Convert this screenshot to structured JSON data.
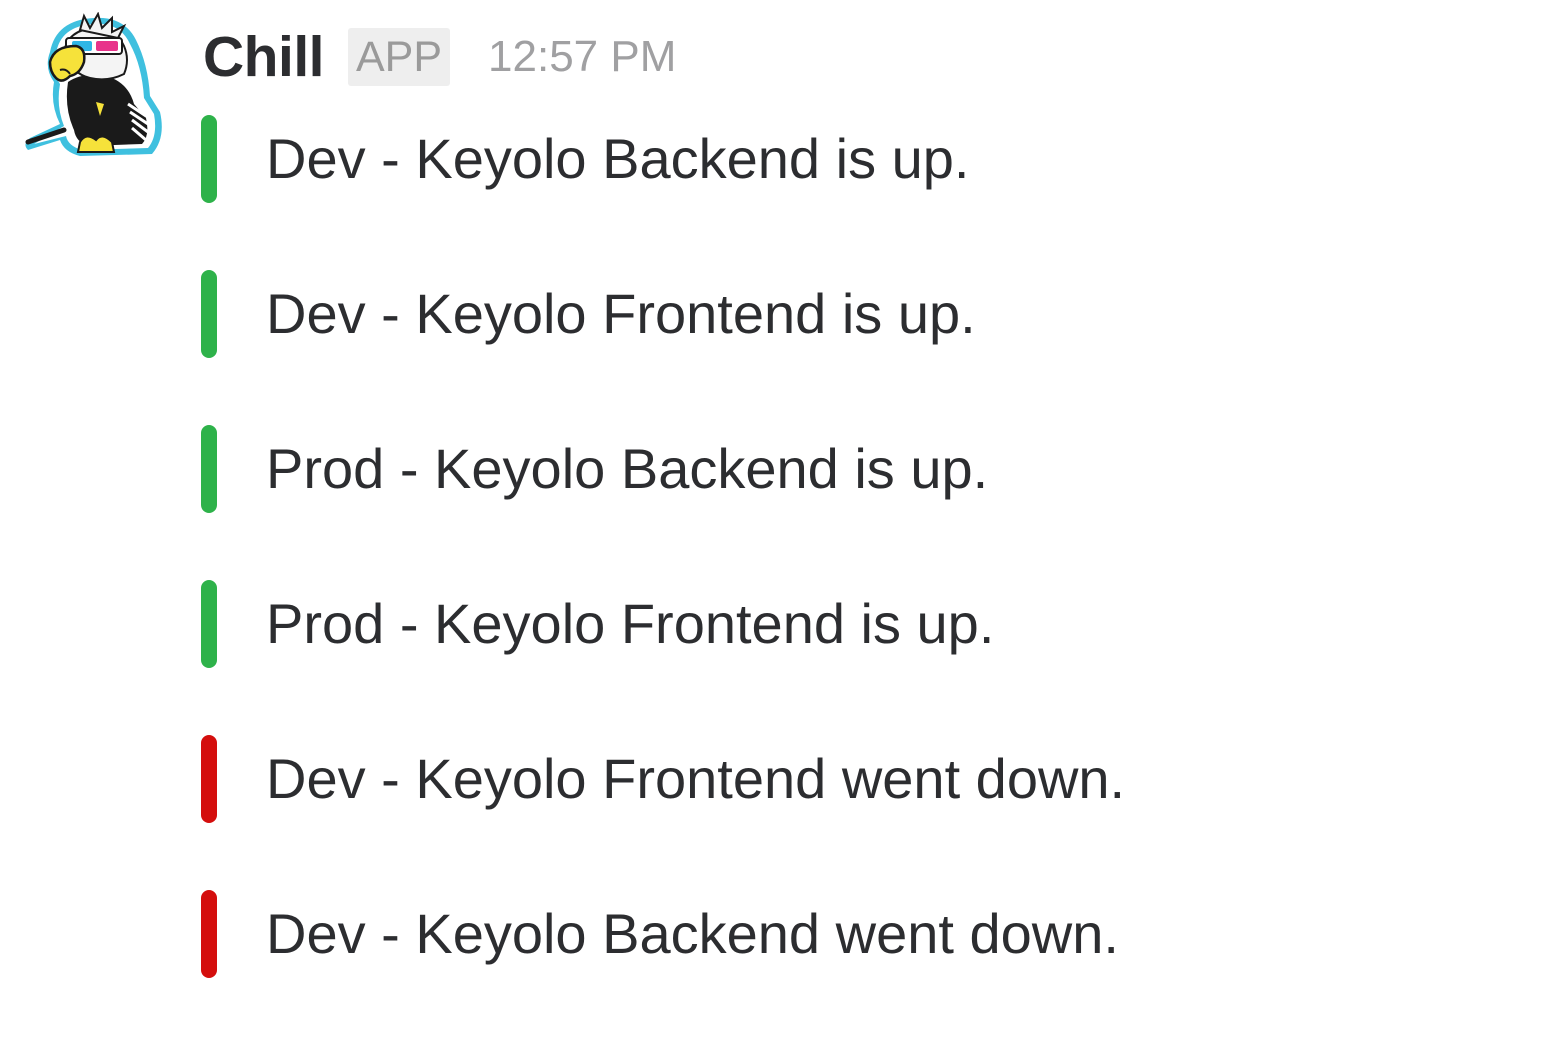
{
  "message": {
    "sender": "Chill",
    "badge": "APP",
    "timestamp": "12:57 PM",
    "avatar_icon": "eagle-with-3d-glasses-avatar-icon"
  },
  "colors": {
    "status_up": "#2eb24a",
    "status_down": "#d40e0d"
  },
  "attachments": [
    {
      "text": "Dev - Keyolo Backend is up.",
      "status": "up"
    },
    {
      "text": "Dev - Keyolo Frontend is up.",
      "status": "up"
    },
    {
      "text": "Prod - Keyolo Backend is up.",
      "status": "up"
    },
    {
      "text": "Prod - Keyolo Frontend is up.",
      "status": "up"
    },
    {
      "text": "Dev - Keyolo Frontend went down.",
      "status": "down"
    },
    {
      "text": "Dev - Keyolo Backend went down.",
      "status": "down"
    }
  ]
}
